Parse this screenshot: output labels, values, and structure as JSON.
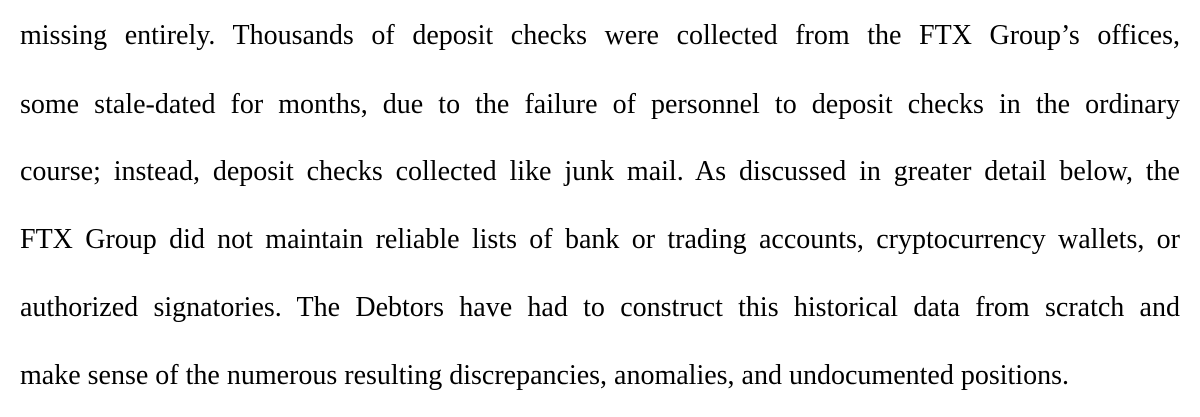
{
  "paragraph": {
    "lines": [
      "missing entirely.  Thousands of deposit checks were collected from the FTX Group’s offices,",
      "some stale-dated for months, due to the failure of personnel to deposit checks in the ordinary",
      "course; instead, deposit checks collected like junk mail.  As discussed in greater detail below, the",
      "FTX Group did not maintain reliable lists of bank or trading accounts, cryptocurrency wallets, or",
      "authorized signatories.  The Debtors have had to construct this historical data from scratch and",
      "make sense of the numerous resulting discrepancies, anomalies, and undocumented positions."
    ]
  }
}
